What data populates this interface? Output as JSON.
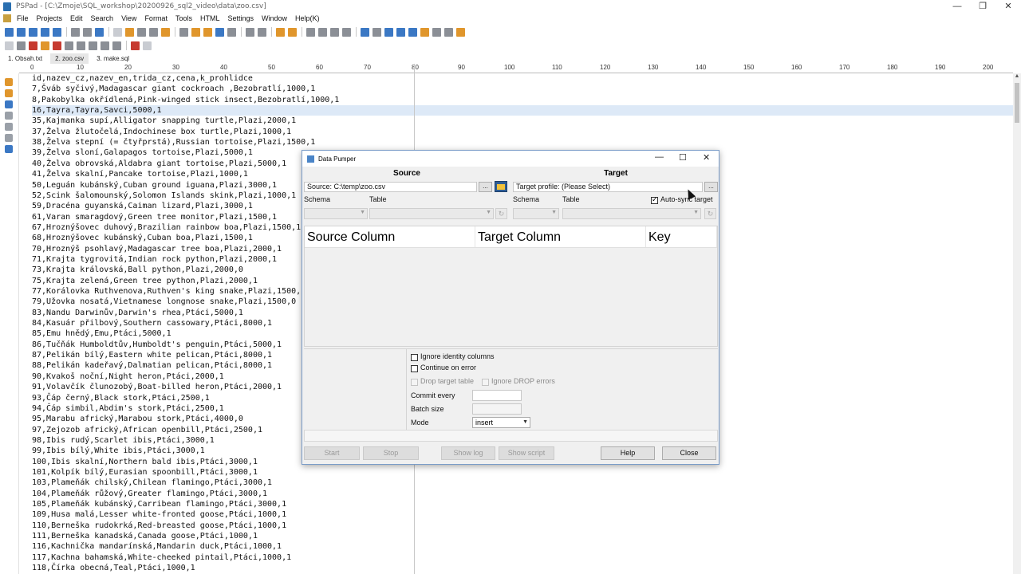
{
  "window": {
    "title": "PSPad - [C:\\Zmoje\\SQL_workshop\\20200926_sql2_video\\data\\zoo.csv]",
    "controls": [
      "—",
      "❐",
      "✕"
    ]
  },
  "menu": [
    "File",
    "Projects",
    "Edit",
    "Search",
    "View",
    "Format",
    "Tools",
    "HTML",
    "Settings",
    "Window",
    "Help(K)"
  ],
  "tabs": [
    "1. Obsah.txt",
    "2. zoo.csv",
    "3. make.sql"
  ],
  "ruler": {
    "ticks": [
      "0",
      "10",
      "20",
      "30",
      "40",
      "50",
      "60",
      "70",
      "80",
      "90",
      "100",
      "110",
      "120",
      "130",
      "140",
      "150",
      "160",
      "170",
      "180",
      "190",
      "200"
    ]
  },
  "editor": {
    "lines": [
      "id,nazev_cz,nazev_en,trida_cz,cena,k_prohlidce",
      "7,Šváb syčivý,Madagascar giant cockroach ,Bezobratlí,1000,1",
      "8,Pakobylka okřídlená,Pink-winged stick insect,Bezobratlí,1000,1",
      "16,Tayra,Tayra,Savci,5000,1",
      "35,Kajmanka supí,Alligator snapping turtle,Plazi,2000,1",
      "37,Želva žlutočelá,Indochinese box turtle,Plazi,1000,1",
      "38,Želva stepní (= čtyřprstá),Russian tortoise,Plazi,1500,1",
      "39,Želva sloní,Galapagos tortoise,Plazi,5000,1",
      "40,Želva obrovská,Aldabra giant tortoise,Plazi,5000,1",
      "41,Želva skalní,Pancake tortoise,Plazi,1000,1",
      "50,Leguán kubánský,Cuban ground iguana,Plazi,3000,1",
      "52,Scink šalomounský,Solomon Islands skink,Plazi,1000,1",
      "59,Dracéna guyanská,Caiman lizard,Plazi,3000,1",
      "61,Varan smaragdový,Green tree monitor,Plazi,1500,1",
      "67,Hroznýšovec duhový,Brazilian rainbow boa,Plazi,1500,1",
      "68,Hroznýšovec kubánský,Cuban boa,Plazi,1500,1",
      "70,Hroznýš psohlavý,Madagascar tree boa,Plazi,2000,1",
      "71,Krajta tygrovitá,Indian rock python,Plazi,2000,1",
      "73,Krajta královská,Ball python,Plazi,2000,0",
      "75,Krajta zelená,Green tree python,Plazi,2000,1",
      "77,Korálovka Ruthvenova,Ruthven's king snake,Plazi,1500,1",
      "79,Užovka nosatá,Vietnamese longnose snake,Plazi,1500,0",
      "83,Nandu Darwinův,Darwin's rhea,Ptáci,5000,1",
      "84,Kasuár přilbový,Southern cassowary,Ptáci,8000,1",
      "85,Emu hnědý,Emu,Ptáci,5000,1",
      "86,Tučňák Humboldtův,Humboldt's penguin,Ptáci,5000,1",
      "87,Pelikán bílý,Eastern white pelican,Ptáci,8000,1",
      "88,Pelikán kadeřavý,Dalmatian pelican,Ptáci,8000,1",
      "90,Kvakoš noční,Night heron,Ptáci,2000,1",
      "91,Volavčík člunozobý,Boat-billed heron,Ptáci,2000,1",
      "93,Čáp černý,Black stork,Ptáci,2500,1",
      "94,Čáp simbil,Abdim's stork,Ptáci,2500,1",
      "95,Marabu africký,Marabou stork,Ptáci,4000,0",
      "97,Zejozob africký,African openbill,Ptáci,2500,1",
      "98,Ibis rudý,Scarlet ibis,Ptáci,3000,1",
      "99,Ibis bílý,White ibis,Ptáci,3000,1",
      "100,Ibis skalní,Northern bald ibis,Ptáci,3000,1",
      "101,Kolpík bílý,Eurasian spoonbill,Ptáci,3000,1",
      "103,Plameňák chilský,Chilean flamingo,Ptáci,3000,1",
      "104,Plameňák růžový,Greater flamingo,Ptáci,3000,1",
      "105,Plameňák kubánský,Carribean flamingo,Ptáci,3000,1",
      "109,Husa malá,Lesser white-fronted goose,Ptáci,1000,1",
      "110,Berneška rudokrká,Red-breasted goose,Ptáci,1000,1",
      "111,Berneška kanadská,Canada goose,Ptáci,1000,1",
      "116,Kachnička mandarínská,Mandarin duck,Ptáci,1000,1",
      "117,Kachna bahamská,White-cheeked pintail,Ptáci,1000,1",
      "118,Čírka obecná,Teal,Ptáci,1000,1"
    ],
    "highlighted_line": 3
  },
  "dialog": {
    "title": "Data Pumper",
    "controls": [
      "—",
      "☐",
      "✕"
    ],
    "source": {
      "header": "Source",
      "value": "Source: C:\\temp\\zoo.csv",
      "browse_label": "...",
      "schema_label": "Schema",
      "table_label": "Table"
    },
    "target": {
      "header": "Target",
      "value": "Target profile: (Please Select)",
      "browse_label": "...",
      "schema_label": "Schema",
      "table_label": "Table",
      "auto_sync_label": "Auto-sync target",
      "auto_sync_checked": true
    },
    "grid": {
      "columns": [
        "Source Column",
        "Target Column",
        "Key"
      ]
    },
    "options": {
      "ignore_identity": "Ignore identity columns",
      "continue_on_error": "Continue on error",
      "drop_target_table": "Drop target table",
      "ignore_drop_errors": "Ignore DROP errors",
      "commit_every": "Commit every",
      "batch_size": "Batch size",
      "mode_label": "Mode",
      "mode_value": "insert"
    },
    "buttons": {
      "start": "Start",
      "stop": "Stop",
      "show_log": "Show log",
      "show_script": "Show script",
      "help": "Help",
      "close": "Close"
    }
  }
}
